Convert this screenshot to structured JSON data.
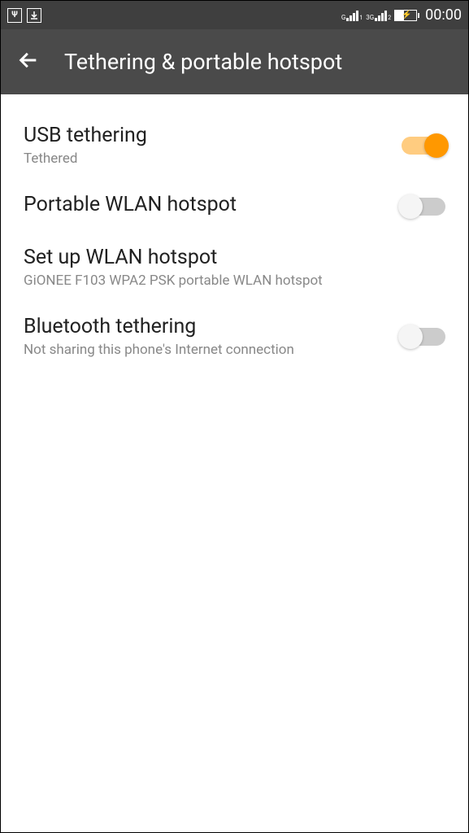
{
  "statusBar": {
    "clock": "00:00",
    "networkLabel1": "G",
    "networkLabel2": "3G",
    "signalSub1": "1",
    "signalSub2": "2"
  },
  "appBar": {
    "title": "Tethering & portable hotspot"
  },
  "settings": {
    "usbTethering": {
      "title": "USB tethering",
      "subtitle": "Tethered",
      "enabled": true
    },
    "portableHotspot": {
      "title": "Portable WLAN hotspot",
      "enabled": false
    },
    "setupHotspot": {
      "title": "Set up WLAN hotspot",
      "subtitle": "GiONEE F103 WPA2 PSK portable WLAN hotspot"
    },
    "bluetoothTethering": {
      "title": "Bluetooth tethering",
      "subtitle": "Not sharing this phone's Internet connection",
      "enabled": false
    }
  }
}
